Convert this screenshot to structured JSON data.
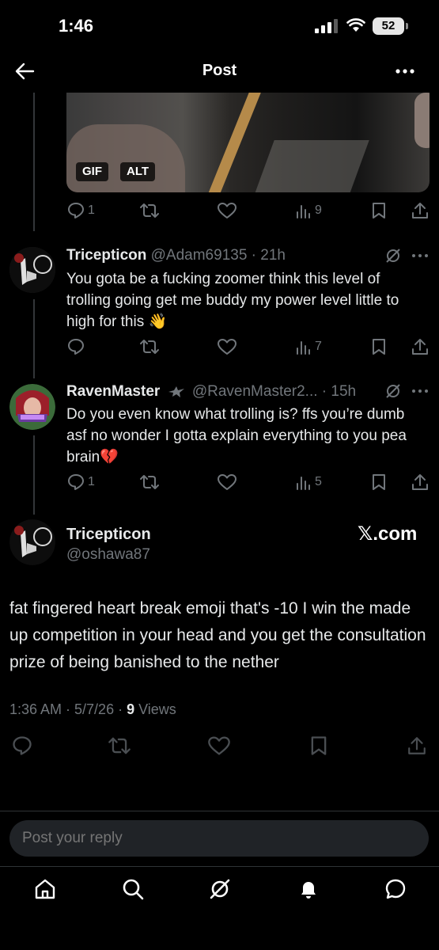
{
  "status_bar": {
    "time": "1:46",
    "battery": "52"
  },
  "header": {
    "title": "Post"
  },
  "media": {
    "badge_gif": "GIF",
    "badge_alt": "ALT"
  },
  "first_post_actions": {
    "replies": "1",
    "views": "9"
  },
  "replies": [
    {
      "name": "Tricepticon",
      "handle": "@Adam69135",
      "time": "21h",
      "text": "You gota be a fucking zoomer think this level of trolling going get me buddy my power level little to high for this 👋",
      "replies": "",
      "views": "7"
    },
    {
      "name": "RavenMaster",
      "handle": "@RavenMaster2...",
      "time": "15h",
      "text": "Do you even know what trolling is? ffs you’re dumb asf no wonder I gotta explain everything to you pea brain💔",
      "replies": "1",
      "views": "5"
    }
  ],
  "main_post": {
    "name": "Tricepticon",
    "handle": "@oshawa87",
    "source": "𝕏.com",
    "text": "fat fingered heart break emoji that's -10 I win the made up competition in your head and you get the consultation prize of being banished to the nether",
    "timestamp": "1:36 AM · 5/7/26 · ",
    "views_count": "9",
    "views_label": " Views"
  },
  "reply_box": {
    "placeholder": "Post your reply"
  },
  "icons": [
    "back-arrow-icon",
    "more-icon",
    "reply-icon",
    "repost-icon",
    "like-icon",
    "views-icon",
    "bookmark-icon",
    "share-icon",
    "grok-icon",
    "home-icon",
    "search-icon",
    "notifications-icon",
    "messages-icon"
  ]
}
